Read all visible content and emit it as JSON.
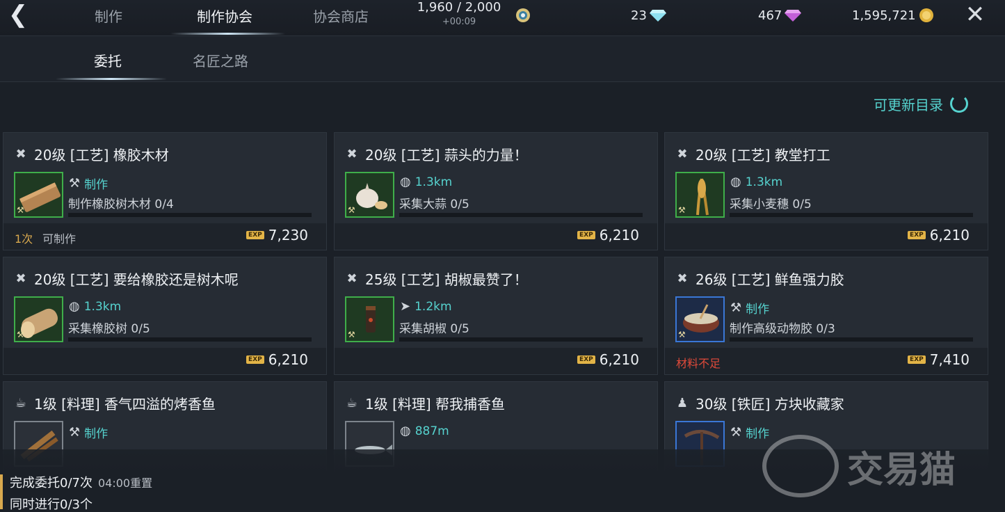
{
  "header": {
    "tabs": [
      "制作",
      "制作协会",
      "协会商店"
    ],
    "energy": "1,960 / 2,000",
    "energy_timer": "+00:09",
    "diamonds_blue": "23",
    "diamonds_pink": "467",
    "gold": "1,595,721"
  },
  "subtabs": [
    "委托",
    "名匠之路"
  ],
  "refresh_label": "可更新目录",
  "cards": [
    {
      "title": "20级 [工艺] 橡胶木材",
      "type_label": "制作",
      "desc": "制作橡胶树木材 0/4",
      "footer_a": "1次",
      "footer_b": "可制作",
      "exp": "7,230"
    },
    {
      "title": "20级 [工艺] 蒜头的力量！",
      "type_label": "1.3km",
      "desc": "采集大蒜 0/5",
      "exp": "6,210"
    },
    {
      "title": "20级 [工艺] 教堂打工",
      "type_label": "1.3km",
      "desc": "采集小麦穗 0/5",
      "exp": "6,210"
    },
    {
      "title": "20级 [工艺] 要给橡胶还是树木呢",
      "type_label": "1.3km",
      "desc": "采集橡胶树 0/5",
      "exp": "6,210"
    },
    {
      "title": "25级 [工艺] 胡椒最赞了！",
      "type_label": "1.2km",
      "desc": "采集胡椒 0/5",
      "exp": "6,210"
    },
    {
      "title": "26级 [工艺] 鲜鱼强力胶",
      "type_label": "制作",
      "desc": "制作高级动物胶 0/3",
      "warn": "材料不足",
      "exp": "7,410"
    },
    {
      "title": "1级 [料理] 香气四溢的烤香鱼",
      "type_label": "制作"
    },
    {
      "title": "1级 [料理] 帮我捕香鱼",
      "type_label": "887m"
    },
    {
      "title": "30级 [铁匠] 方块收藏家",
      "type_label": "制作"
    }
  ],
  "bottom": {
    "completed": "完成委托0/7次",
    "reset": "04:00重置",
    "concurrent": "同时进行0/3个"
  },
  "watermark": "交易猫",
  "colors": {
    "accent": "#56d3cf",
    "gold": "#d9a94e",
    "warning": "#e04a3a",
    "green_frame": "#3fae4a",
    "blue_frame": "#3a77d6"
  }
}
